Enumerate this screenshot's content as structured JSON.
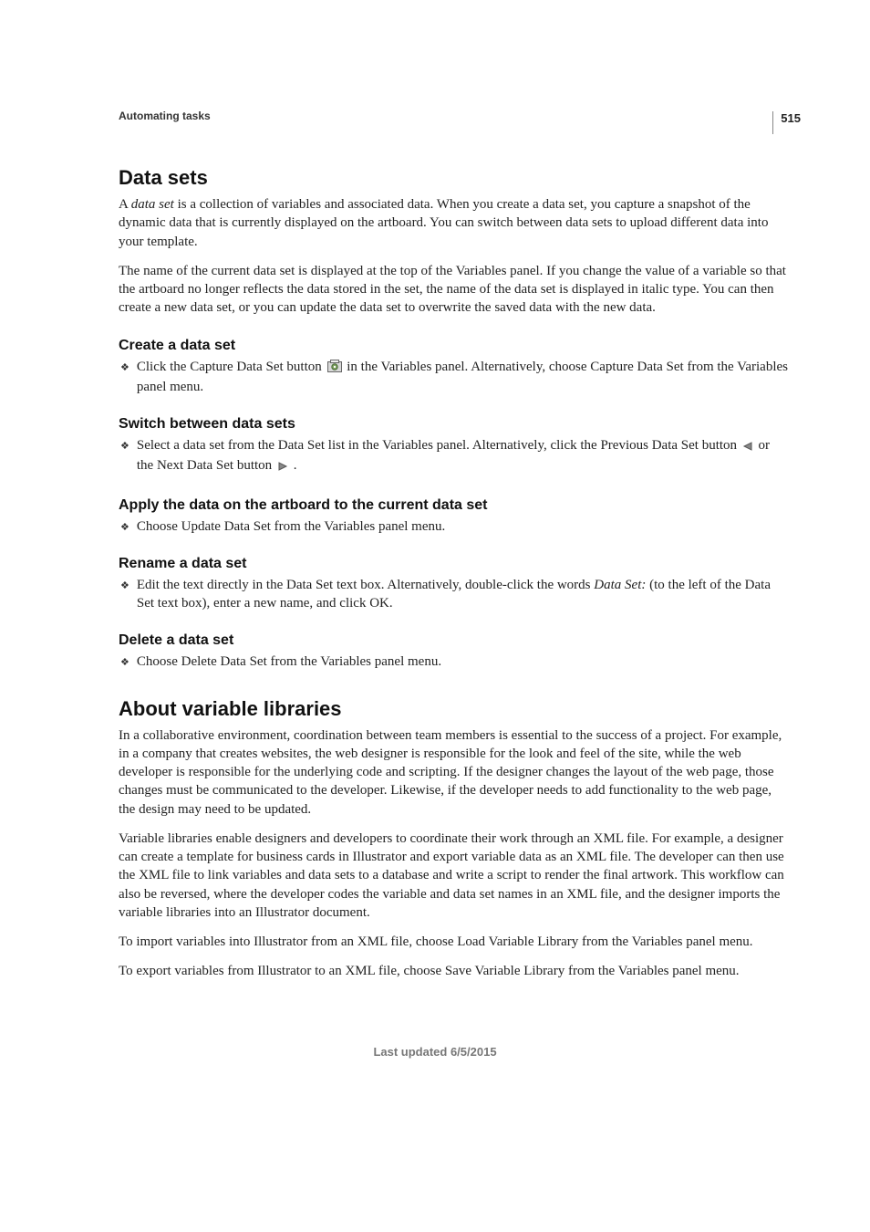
{
  "page_number": "515",
  "chapter_title": "Automating tasks",
  "footer": "Last updated 6/5/2015",
  "sec1": {
    "title": "Data sets",
    "para1_a": "A ",
    "para1_b": "data set",
    "para1_c": " is a collection of variables and associated data. When you create a data set, you capture a snapshot of the dynamic data that is currently displayed on the artboard. You can switch between data sets to upload different data into your template.",
    "para2": "The name of the current data set is displayed at the top of the Variables panel. If you change the value of a variable so that the artboard no longer reflects the data stored in the set, the name of the data set is displayed in italic type. You can then create a new data set, or you can update the data set to overwrite the saved data with the new data.",
    "sub1": {
      "title": "Create a data set",
      "bullet_a": "Click the Capture Data Set button ",
      "bullet_b": " in the Variables panel. Alternatively, choose Capture Data Set from the Variables panel menu."
    },
    "sub2": {
      "title": "Switch between data sets",
      "bullet_a": "Select a data set from the Data Set list in the Variables panel. Alternatively, click the Previous Data Set button ",
      "bullet_b": " or the Next Data Set button ",
      "bullet_c": " ."
    },
    "sub3": {
      "title": "Apply the data on the artboard to the current data set",
      "bullet": "Choose Update Data Set from the Variables panel menu."
    },
    "sub4": {
      "title": "Rename a data set",
      "bullet_a": "Edit the text directly in the Data Set text box. Alternatively, double-click the words ",
      "bullet_b": "Data Set:",
      "bullet_c": " (to the left of the Data Set text box), enter a new name, and click OK."
    },
    "sub5": {
      "title": "Delete a data set",
      "bullet": "Choose Delete Data Set from the Variables panel menu."
    }
  },
  "sec2": {
    "title": "About variable libraries",
    "para1": "In a collaborative environment, coordination between team members is essential to the success of a project. For example, in a company that creates websites, the web designer is responsible for the look and feel of the site, while the web developer is responsible for the underlying code and scripting. If the designer changes the layout of the web page, those changes must be communicated to the developer. Likewise, if the developer needs to add functionality to the web page, the design may need to be updated.",
    "para2": "Variable libraries enable designers and developers to coordinate their work through an XML file. For example, a designer can create a template for business cards in Illustrator and export variable data as an XML file. The developer can then use the XML file to link variables and data sets to a database and write a script to render the final artwork. This workflow can also be reversed, where the developer codes the variable and data set names in an XML file, and the designer imports the variable libraries into an Illustrator document.",
    "para3": "To import variables into Illustrator from an XML file, choose Load Variable Library from the Variables panel menu.",
    "para4": "To export variables from Illustrator to an XML file, choose Save Variable Library from the Variables panel menu."
  }
}
